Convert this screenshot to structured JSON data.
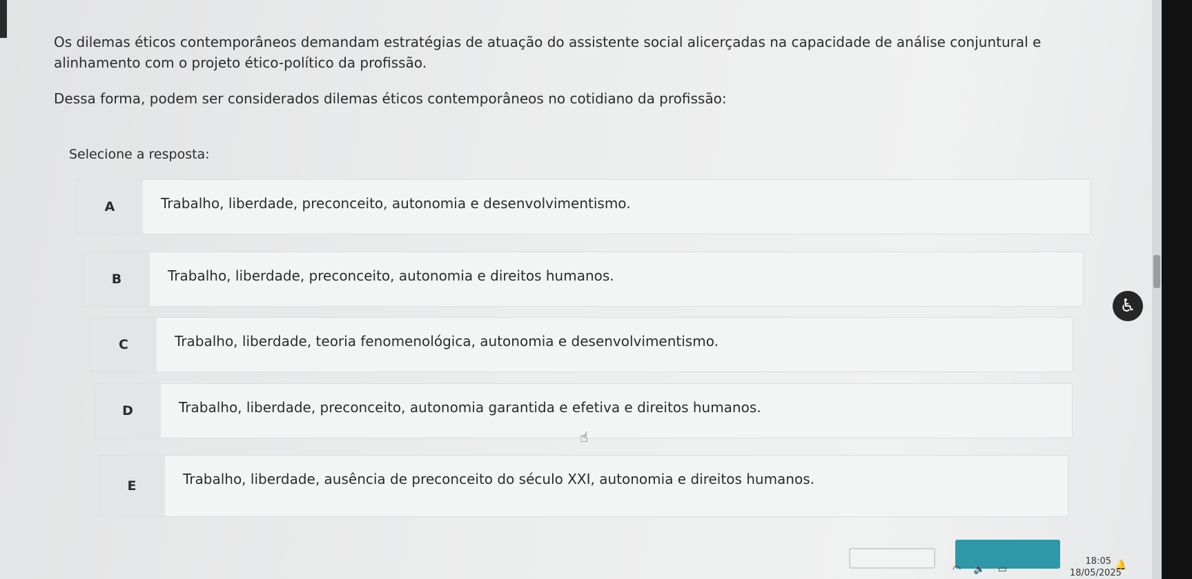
{
  "question": {
    "paragraph1": "Os dilemas éticos contemporâneos demandam estratégias de atuação do assistente social alicerçadas na capacidade de análise conjuntural e alinhamento com o projeto ético-político da profissão.",
    "paragraph2": "Dessa forma, podem ser considerados dilemas éticos contemporâneos no cotidiano da profissão:"
  },
  "select_label": "Selecione a resposta:",
  "options": [
    {
      "letter": "A",
      "text": "Trabalho, liberdade, preconceito, autonomia e desenvolvimentismo."
    },
    {
      "letter": "B",
      "text": "Trabalho, liberdade, preconceito, autonomia e direitos humanos."
    },
    {
      "letter": "C",
      "text": "Trabalho, liberdade, teoria fenomenológica, autonomia e desenvolvimentismo."
    },
    {
      "letter": "D",
      "text": "Trabalho, liberdade, preconceito, autonomia garantida e efetiva e direitos humanos."
    },
    {
      "letter": "E",
      "text": "Trabalho, liberdade, ausência de preconceito do século XXI, autonomia e direitos humanos."
    }
  ],
  "accessibility": {
    "icon": "accessibility-icon",
    "glyph": "♿"
  },
  "cursor": {
    "icon": "hand-pointer-icon",
    "glyph": "☝"
  },
  "taskbar": {
    "time": "18:05",
    "date": "18/05/2025",
    "wifi_glyph": "◠",
    "volume_glyph": "🔈",
    "battery_glyph": "▭",
    "bell_glyph": "🔔"
  },
  "colors": {
    "accent": "#2e97a8"
  }
}
